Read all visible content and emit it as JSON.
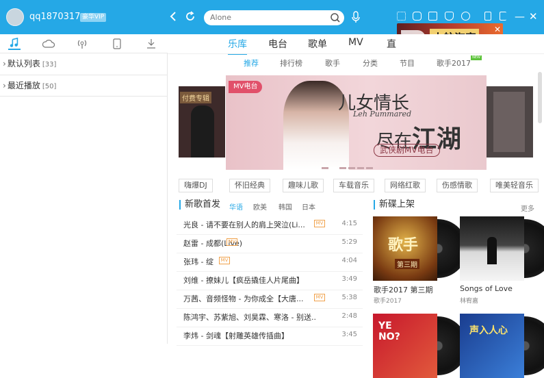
{
  "user": {
    "name": "qq1870317...",
    "vip": "豪华VIP"
  },
  "search": {
    "value": "Alone"
  },
  "ad": {
    "title": "大航海家"
  },
  "left_nav": [
    "music-note-icon",
    "cloud-icon",
    "radio-icon",
    "device-icon",
    "download-icon"
  ],
  "playlists": [
    {
      "label": "默认列表",
      "count": "[33]"
    },
    {
      "label": "最近播放",
      "count": "[50]"
    }
  ],
  "main_tabs": [
    "乐库",
    "电台",
    "歌单",
    "MV",
    "直"
  ],
  "sub_tabs": [
    "推荐",
    "排行榜",
    "歌手",
    "分类",
    "节目",
    "歌手2017"
  ],
  "new_badge": "NEW",
  "banner": {
    "tag": "MV电台",
    "left_label": "付费专辑",
    "t1": "儿女情长",
    "t2": "Leh Pummared",
    "t3": "尽在",
    "t3b": "江湖",
    "t4": "武侠剧MV电台"
  },
  "tags": [
    "嗨爆DJ",
    "怀旧经典",
    "趣味儿歌",
    "车载音乐",
    "网络红歌",
    "伤感情歌",
    "唯美轻音乐"
  ],
  "new_songs": {
    "title": "新歌首发",
    "langs": [
      "华语",
      "欧美",
      "韩国",
      "日本"
    ]
  },
  "new_albums": {
    "title": "新碟上架",
    "more": "更多"
  },
  "songs": [
    {
      "title": "光良 - 请不要在别人的肩上哭泣(Li...",
      "mv": "MV",
      "dur": "4:15"
    },
    {
      "title": "赵雷 - 成都(Live)",
      "mv": "MV",
      "dur": "5:29"
    },
    {
      "title": "张玮 - 绽",
      "mv": "MV",
      "dur": "4:04"
    },
    {
      "title": "刘维 - 撩妹儿【疯岳撬佳人片尾曲】",
      "mv": "",
      "dur": "3:49"
    },
    {
      "title": "万茜、音频怪物 - 为你成全【大唐...",
      "mv": "MV",
      "dur": "5:38"
    },
    {
      "title": "陈鸿宇、苏紫旭、刘昊霖、寒洛 - 别送...",
      "mv": "",
      "dur": "2:48"
    },
    {
      "title": "李炜 - 剑魂【射雕英雄传插曲】",
      "mv": "",
      "dur": "3:45"
    }
  ],
  "albums": [
    {
      "title": "歌手2017 第三期",
      "sub": "歌手2017",
      "cover_text": "歌手",
      "cover_sub": "第三期"
    },
    {
      "title": "Songs of Love",
      "sub": "林宥嘉",
      "cover_text": "",
      "cover_sub": ""
    },
    {
      "title": "",
      "sub": "",
      "cover_text": "YE NO?",
      "cover_sub": ""
    },
    {
      "title": "",
      "sub": "",
      "cover_text": "声入人心",
      "cover_sub": ""
    }
  ],
  "colors": {
    "accent": "#25a8e6",
    "tagred": "#e1506a"
  }
}
